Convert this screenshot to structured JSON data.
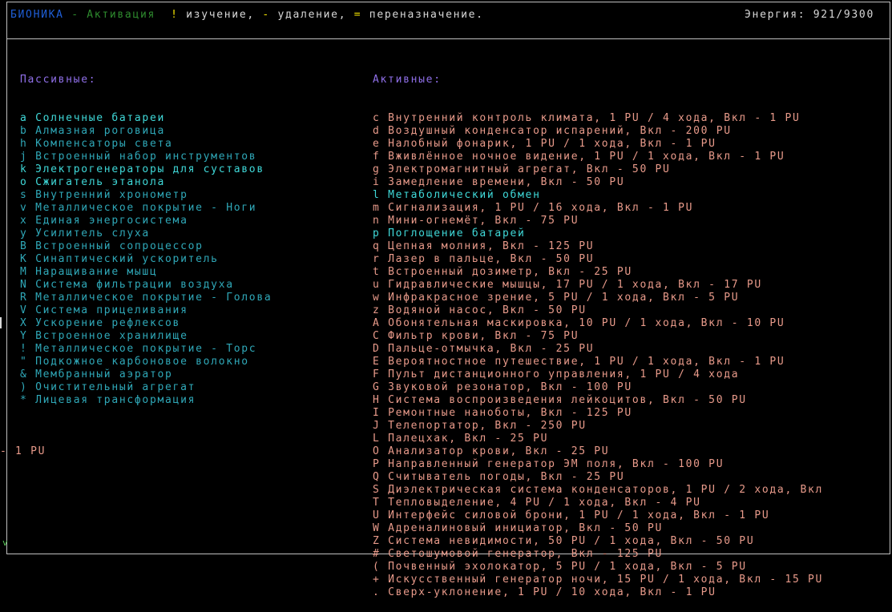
{
  "header": {
    "title": "БИОНИКА",
    "separator": " - ",
    "mode": "Активация",
    "hint_key_study": "!",
    "hint_study": " изучение, ",
    "hint_key_remove": "-",
    "hint_remove": " удаление, ",
    "hint_key_reassign": "=",
    "hint_reassign": " переназначение.",
    "energy": "Энергия: 921/9300"
  },
  "colors": {
    "title": "#1f5fd8",
    "mode": "#2e8b2e",
    "hint_key": "#f0e000",
    "hint_text": "#d8d8d8",
    "section": "#8f6fe8",
    "passive_active": "#3fd8d8",
    "passive_inactive": "#2fa8b8",
    "active_on": "#3fd8d8",
    "active_off": "#e89a8a"
  },
  "passive": {
    "heading": "Пассивные:",
    "items": [
      {
        "key": "a",
        "name": "Солнечные батареи",
        "on": true
      },
      {
        "key": "b",
        "name": "Алмазная роговица",
        "on": false
      },
      {
        "key": "h",
        "name": "Компенсаторы света",
        "on": false
      },
      {
        "key": "j",
        "name": "Встроенный набор инструментов",
        "on": false
      },
      {
        "key": "k",
        "name": "Электрогенераторы для суставов",
        "on": true
      },
      {
        "key": "o",
        "name": "Сжигатель этанола",
        "on": true
      },
      {
        "key": "s",
        "name": "Внутренний хронометр",
        "on": false
      },
      {
        "key": "v",
        "name": "Металлическое покрытие - Ноги",
        "on": false
      },
      {
        "key": "x",
        "name": "Единая энергосистема",
        "on": false
      },
      {
        "key": "y",
        "name": "Усилитель слуха",
        "on": false
      },
      {
        "key": "B",
        "name": "Встроенный сопроцессор",
        "on": false
      },
      {
        "key": "K",
        "name": "Синаптический ускоритель",
        "on": false
      },
      {
        "key": "M",
        "name": "Наращивание мышц",
        "on": false
      },
      {
        "key": "N",
        "name": "Система фильтрации воздуха",
        "on": false
      },
      {
        "key": "R",
        "name": "Металлическое покрытие - Голова",
        "on": false
      },
      {
        "key": "V",
        "name": "Система прицеливания",
        "on": false
      },
      {
        "key": "X",
        "name": "Ускорение рефлексов",
        "on": false
      },
      {
        "key": "Y",
        "name": "Встроенное хранилище",
        "on": false
      },
      {
        "key": "!",
        "name": "Металлическое покрытие - Торс",
        "on": false
      },
      {
        "key": "\"",
        "name": "Подкожное карбоновое волокно",
        "on": false
      },
      {
        "key": "&",
        "name": "Мембранный аэратор",
        "on": false
      },
      {
        "key": ")",
        "name": "Очистительный агрегат",
        "on": false
      },
      {
        "key": "*",
        "name": "Лицевая трансформация",
        "on": false
      }
    ]
  },
  "active": {
    "heading": "Активные:",
    "items": [
      {
        "key": "c",
        "name": "Внутренний контроль климата, 1 PU / 4 хода, Вкл - 1 PU",
        "on": false
      },
      {
        "key": "d",
        "name": "Воздушный конденсатор испарений, Вкл - 200 PU",
        "on": false
      },
      {
        "key": "e",
        "name": "Налобный фонарик, 1 PU / 1 хода, Вкл - 1 PU",
        "on": false
      },
      {
        "key": "f",
        "name": "Вживлённое ночное видение, 1 PU / 1 хода, Вкл - 1 PU",
        "on": false
      },
      {
        "key": "g",
        "name": "Электромагнитный агрегат, Вкл - 50 PU",
        "on": false
      },
      {
        "key": "i",
        "name": "Замедление времени, Вкл - 50 PU",
        "on": false
      },
      {
        "key": "l",
        "name": "Метаболический обмен",
        "on": true
      },
      {
        "key": "m",
        "name": "Сигнализация, 1 PU / 16 хода, Вкл - 1 PU",
        "on": false
      },
      {
        "key": "n",
        "name": "Мини-огнемёт, Вкл - 75 PU",
        "on": false
      },
      {
        "key": "p",
        "name": "Поглощение батарей",
        "on": true
      },
      {
        "key": "q",
        "name": "Цепная молния, Вкл - 125 PU",
        "on": false
      },
      {
        "key": "r",
        "name": "Лазер в пальце, Вкл - 50 PU",
        "on": false
      },
      {
        "key": "t",
        "name": "Встроенный дозиметр, Вкл - 25 PU",
        "on": false
      },
      {
        "key": "u",
        "name": "Гидравлические мышцы, 17 PU / 1 хода, Вкл - 17 PU",
        "on": false
      },
      {
        "key": "w",
        "name": "Инфракрасное зрение, 5 PU / 1 хода, Вкл - 5 PU",
        "on": false
      },
      {
        "key": "z",
        "name": "Водяной насос, Вкл - 50 PU",
        "on": false
      },
      {
        "key": "A",
        "name": "Обонятельная маскировка, 10 PU / 1 хода, Вкл - 10 PU",
        "on": false
      },
      {
        "key": "C",
        "name": "Фильтр крови, Вкл - 75 PU",
        "on": false
      },
      {
        "key": "D",
        "name": "Пальце-отмычка, Вкл - 25 PU",
        "on": false
      },
      {
        "key": "E",
        "name": "Вероятностное путешествие, 1 PU / 1 хода, Вкл - 1 PU",
        "on": false
      },
      {
        "key": "F",
        "name": "Пульт дистанционного управления, 1 PU / 4 хода",
        "on": false
      },
      {
        "key": "G",
        "name": "Звуковой резонатор, Вкл - 100 PU",
        "on": false
      },
      {
        "key": "H",
        "name": "Система воспроизведения лейкоцитов, Вкл - 50 PU",
        "on": false
      },
      {
        "key": "I",
        "name": "Ремонтные нанoботы, Вкл - 125 PU",
        "on": false
      },
      {
        "key": "J",
        "name": "Телепортатор, Вкл - 250 PU",
        "on": false
      },
      {
        "key": "L",
        "name": "Палецхак, Вкл - 25 PU",
        "on": false
      },
      {
        "key": "O",
        "name": "Анализатор крови, Вкл - 25 PU",
        "on": false
      },
      {
        "key": "P",
        "name": "Направленный генератор ЭМ поля, Вкл - 100 PU",
        "on": false
      },
      {
        "key": "Q",
        "name": "Считыватель погоды, Вкл - 25 PU",
        "on": false
      },
      {
        "key": "S",
        "name": "Диэлектрическая система конденсаторов, 1 PU / 2 хода, Вкл",
        "on": false
      },
      {
        "key": "T",
        "name": "Тепловыделение, 4 PU / 1 хода, Вкл - 4 PU",
        "on": false
      },
      {
        "key": "U",
        "name": "Интерфейс силовой брони, 1 PU / 1 хода, Вкл - 1 PU",
        "on": false
      },
      {
        "key": "W",
        "name": "Адреналиновый инициатор, Вкл - 50 PU",
        "on": false
      },
      {
        "key": "Z",
        "name": "Система невидимости, 50 PU / 1 хода, Вкл - 50 PU",
        "on": false
      },
      {
        "key": "#",
        "name": "Светошумовой генератор, Вкл - 125 PU",
        "on": false
      },
      {
        "key": "(",
        "name": "Почвенный эхолокатор, 5 PU / 1 хода, Вкл - 5 PU",
        "on": false
      },
      {
        "key": "+",
        "name": "Искусственный генератор ночи, 15 PU / 1 хода, Вкл - 15 PU",
        "on": false
      },
      {
        "key": ".",
        "name": "Сверх-уклонение, 1 PU / 10 хода, Вкл - 1 PU",
        "on": false
      }
    ]
  },
  "overflow_text": "- 1 PU",
  "bottom_mark": "v"
}
